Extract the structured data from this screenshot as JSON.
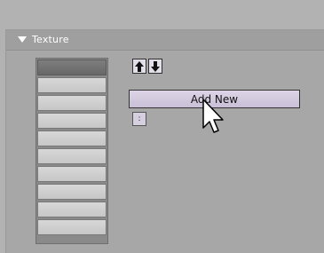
{
  "panel": {
    "title": "Texture",
    "add_new_label": "Add New",
    "small_button_label": ":",
    "slot_count": 10
  }
}
